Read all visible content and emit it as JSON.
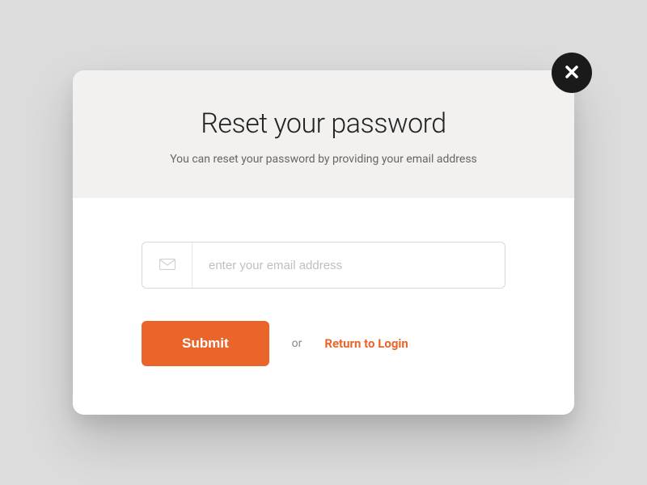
{
  "modal": {
    "title": "Reset your password",
    "subtitle": "You can reset your password by providing your email address",
    "email_placeholder": "enter your email address",
    "submit_label": "Submit",
    "or_label": "or",
    "return_link_label": "Return to Login"
  }
}
